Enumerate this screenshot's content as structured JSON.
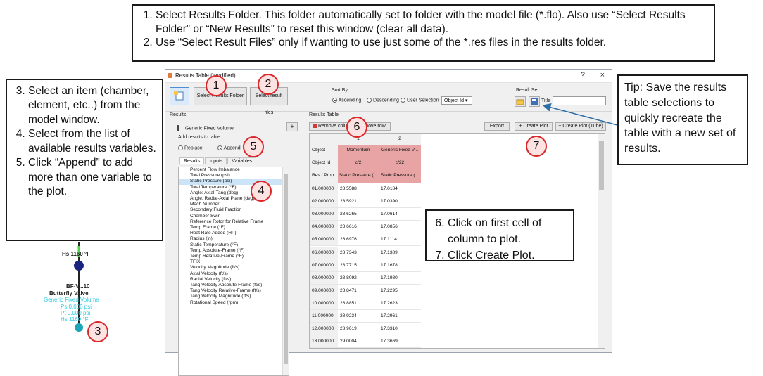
{
  "top_callout": {
    "items": [
      "Select Results Folder.  This folder automatically set to folder with the model file (*.flo).  Also use “Select Results Folder” or “New Results” to reset this window (clear all data).",
      "Use “Select Result Files” only if wanting to use just some of the *.res files in the results folder."
    ]
  },
  "left_callout": {
    "items": [
      "Select an item (chamber, element, etc..) from the model window.",
      "Select from the list of available results variables.",
      "Click “Append” to add more than one variable to the plot."
    ]
  },
  "tip_callout": {
    "text": "Tip: Save the results table selections to quickly recreate the table with a new set of results."
  },
  "mid_callout": {
    "items": [
      "Click on first cell of column to plot.",
      "Click Create Plot."
    ]
  },
  "markers": [
    "1",
    "2",
    "3",
    "4",
    "5",
    "6",
    "7"
  ],
  "window": {
    "title": "Results Table (modified)",
    "help": "?",
    "close": "×",
    "select_results_folder": "Select Results Folder",
    "select_result_files": "Select result files",
    "sort_by": {
      "label": "Sort By",
      "options": [
        "Ascending",
        "Descending",
        "User Selection"
      ],
      "selected": "Ascending",
      "select_value": "Object Id"
    },
    "result_set": {
      "label": "Result Set",
      "title_label": "Title",
      "title_value": ""
    },
    "results_label": "Results",
    "item_name": "Generic Fixed Volume",
    "add_button": "+",
    "add_results_label": "Add results to table",
    "replace_label": "Replace",
    "append_label": "Append",
    "append_selected": true,
    "tabs": [
      "Results",
      "Inputs",
      "Variables"
    ],
    "active_tab": "Results",
    "variables": [
      "Percent Flow Imbalance",
      "Total Pressure (psi)",
      "Static Pressure (psi)",
      "Total Temperature (°F)",
      "Angle: Axial-Tang (deg)",
      "Angle: Radial-Axial Plane (deg)",
      "Mach Number",
      "Secondary Fluid Fraction",
      "Chamber Swirl",
      "Reference Rotor for Relative Frame",
      "Temp Frame (°F)",
      "Heat Rate Added (HP)",
      "Radius (in)",
      "Static Temperature (°F)",
      "Temp Absolute-Frame (°F)",
      "Temp Relative-Frame (°F)",
      "TFIX",
      "Velocity Magnitude (ft/s)",
      "Axial Velocity (ft/s)",
      "Radial Velocity (ft/s)",
      "Tang Velocity Absolute-Frame (ft/s)",
      "Tang Velocity Relative-Frame (ft/s)",
      "Tang Velocity Magnitude (ft/s)",
      "Rotational Speed (rpm)"
    ],
    "selected_variable": "Static Pressure (psi)",
    "results_table_label": "Results Table",
    "remove_column": "Remove column",
    "remove_row": "Remove row",
    "export": "Export",
    "create_plot": "+ Create Plot",
    "create_plot_tube": "+ Create Plot (Tube)",
    "table": {
      "col_numbers": [
        "1",
        "2"
      ],
      "row_headers": [
        "Object",
        "Object Id",
        "Res / Prop"
      ],
      "object": [
        "Momentum",
        "Generic Fixed V..."
      ],
      "object_id": [
        "c/2",
        "c/22"
      ],
      "res_prop": [
        "Static Pressure (...",
        "Static Pressure (..."
      ],
      "rows": [
        [
          "01.000000",
          "28.5588",
          "17.0184"
        ],
        [
          "02.000000",
          "28.5921",
          "17.0390"
        ],
        [
          "03.000000",
          "28.6265",
          "17.0614"
        ],
        [
          "04.000000",
          "28.6616",
          "17.0856"
        ],
        [
          "05.000000",
          "28.6976",
          "17.1114"
        ],
        [
          "06.000000",
          "28.7343",
          "17.1389"
        ],
        [
          "07.000000",
          "28.7715",
          "17.1678"
        ],
        [
          "08.000000",
          "28.8092",
          "17.1980"
        ],
        [
          "09.000000",
          "28.8471",
          "17.2295"
        ],
        [
          "10.000000",
          "28.8851",
          "17.2623"
        ],
        [
          "11.000000",
          "28.9234",
          "17.2961"
        ],
        [
          "12.000000",
          "28.9619",
          "17.3310"
        ],
        [
          "13.000000",
          "29.0004",
          "17.3669"
        ]
      ]
    }
  },
  "schematic": {
    "top_label": "Hs 1160 °F",
    "element_label": "BF-V...10",
    "element_sub": "Butterfly Valve",
    "lines": [
      "Generic Fixed Volume",
      "Ps 0.000 psi",
      "Pt 0.000 psi",
      "Hs 1160 °F"
    ]
  },
  "colors": {
    "marker_border": "#d9282b",
    "marker_fill": "#fde2e2",
    "pink_cells": "#e8a4a4",
    "arrow": "#2e6ea6"
  }
}
